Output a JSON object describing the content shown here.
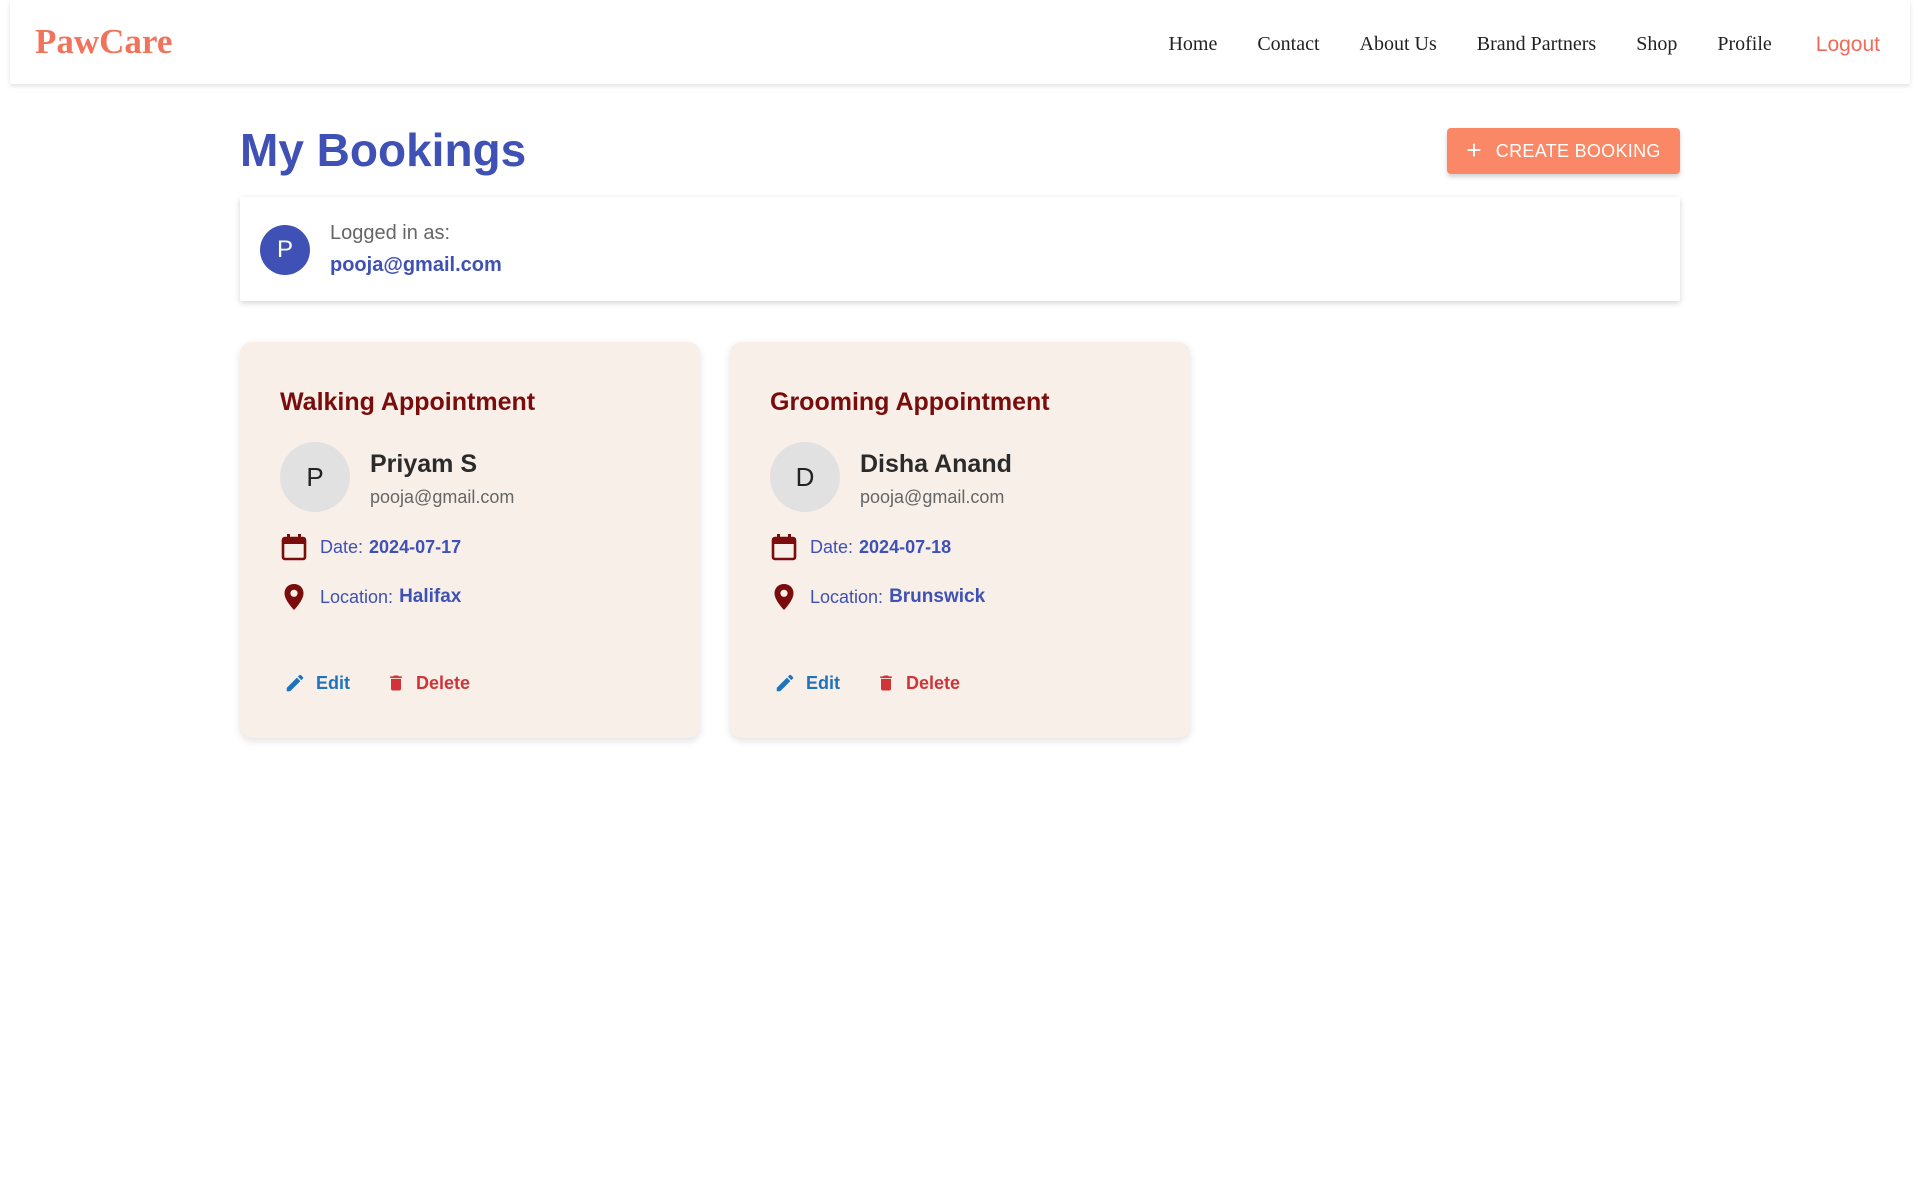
{
  "nav": {
    "brand": "PawCare",
    "links": [
      "Home",
      "Contact",
      "About Us",
      "Brand Partners",
      "Shop",
      "Profile"
    ],
    "logout": "Logout"
  },
  "header": {
    "title": "My Bookings",
    "create_button": "CREATE BOOKING"
  },
  "login": {
    "avatar_letter": "P",
    "label": "Logged in as:",
    "email": "pooja@gmail.com"
  },
  "bookings": [
    {
      "title": "Walking Appointment",
      "avatar_letter": "P",
      "name": "Priyam S",
      "email": "pooja@gmail.com",
      "date_label": "Date:",
      "date": "2024-07-17",
      "location_label": "Location:",
      "location": "Halifax",
      "edit": "Edit",
      "delete": "Delete"
    },
    {
      "title": "Grooming Appointment",
      "avatar_letter": "D",
      "name": "Disha Anand",
      "email": "pooja@gmail.com",
      "date_label": "Date:",
      "date": "2024-07-18",
      "location_label": "Location:",
      "location": "Brunswick",
      "edit": "Edit",
      "delete": "Delete"
    }
  ],
  "colors": {
    "brand": "#f0735c",
    "primary": "#3f51b5",
    "accent_button": "#fa8866",
    "card_background": "#f7efe8",
    "card_title": "#7a0c0c",
    "edit": "#1e73be",
    "delete": "#d13438"
  },
  "icons": {
    "create": "plus-icon",
    "date": "calendar-icon",
    "location": "location-pin-icon",
    "edit": "pencil-icon",
    "delete": "trash-icon"
  }
}
